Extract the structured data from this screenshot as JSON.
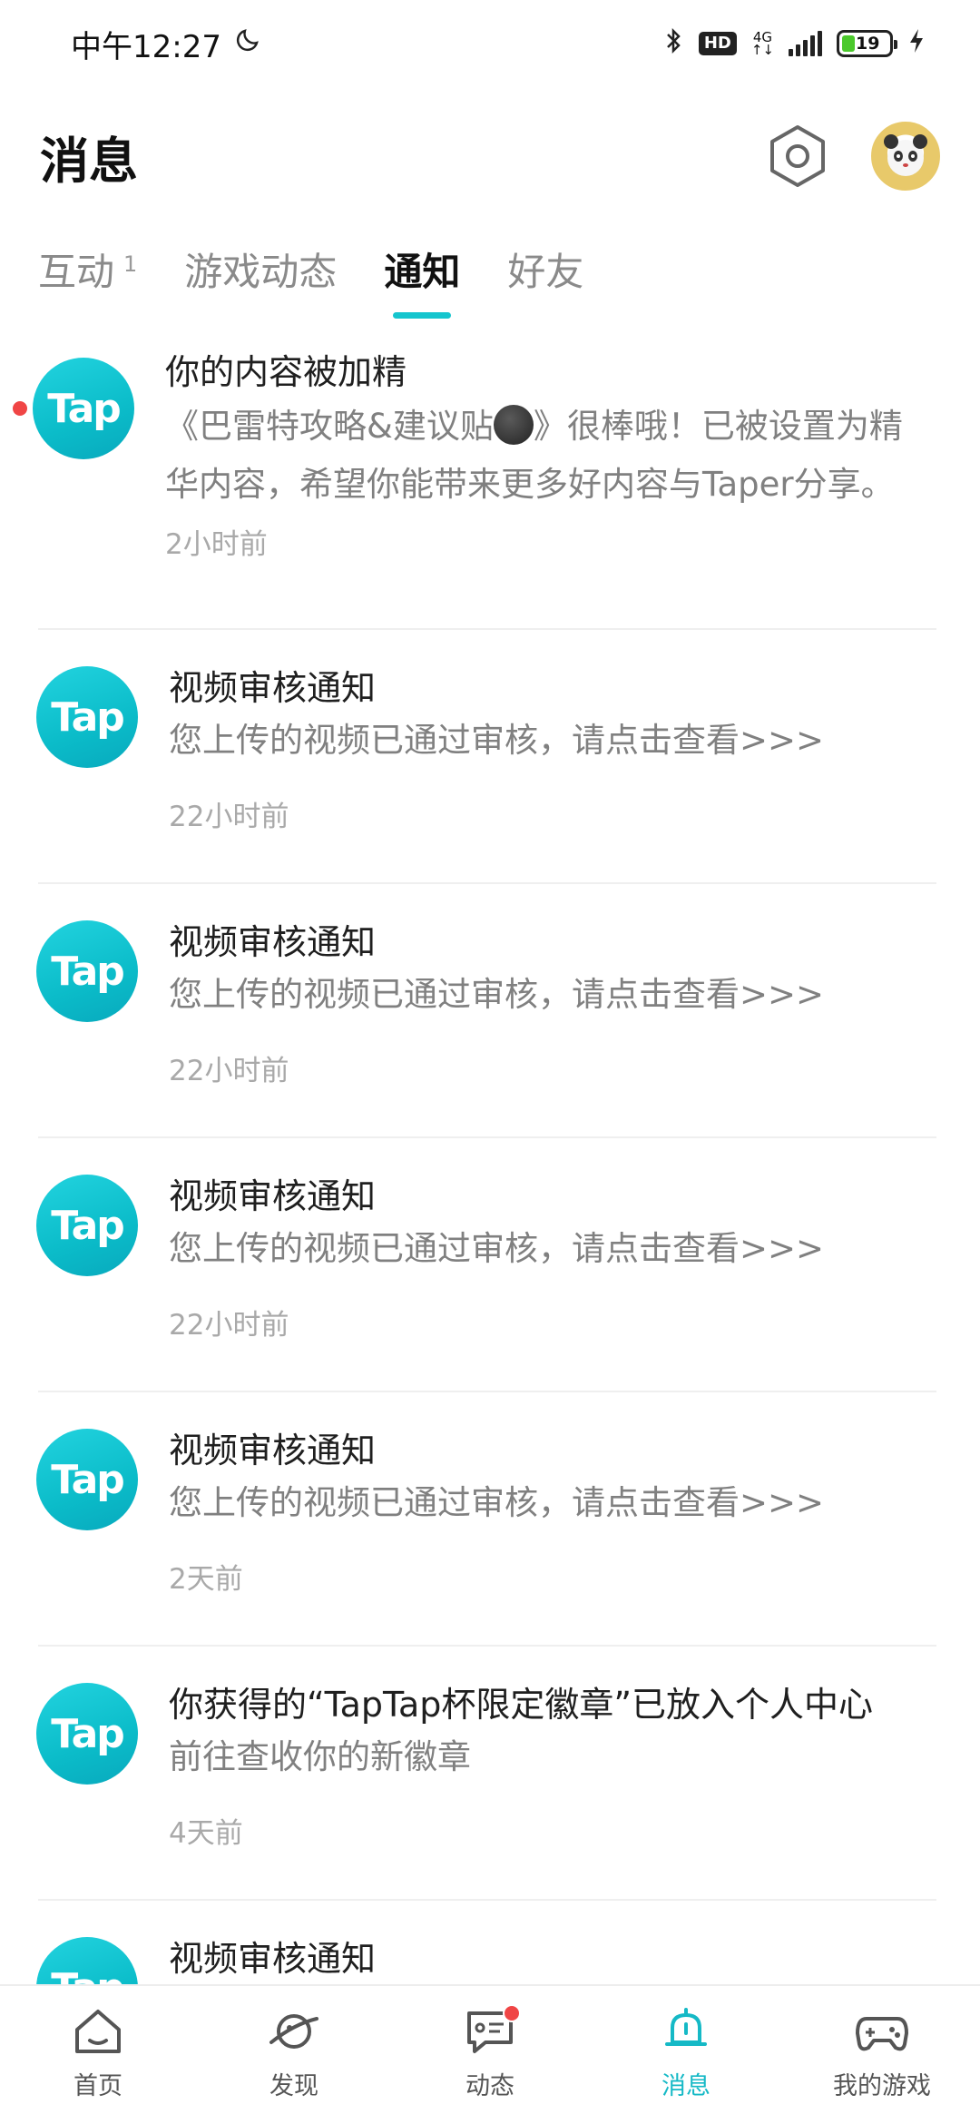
{
  "status_bar": {
    "time": "中午12:27",
    "hd": "HD",
    "network": "4G",
    "battery": "19"
  },
  "header": {
    "title": "消息"
  },
  "tabs": [
    {
      "label": "互动",
      "count": "1"
    },
    {
      "label": "游戏动态"
    },
    {
      "label": "通知",
      "active": true
    },
    {
      "label": "好友"
    }
  ],
  "notifications": [
    {
      "logo": "Tap",
      "title": "你的内容被加精",
      "desc_line1_a": "《巴雷特攻略&建议贴",
      "desc_line1_b": "》很棒哦！已被设置为精",
      "desc_line2": "华内容，希望你能带来更多好内容与Taper分享。",
      "time": "2小时前",
      "unread": true
    },
    {
      "logo": "Tap",
      "title": "视频审核通知",
      "desc": "您上传的视频已通过审核，请点击查看>>>",
      "time": "22小时前"
    },
    {
      "logo": "Tap",
      "title": "视频审核通知",
      "desc": "您上传的视频已通过审核，请点击查看>>>",
      "time": "22小时前"
    },
    {
      "logo": "Tap",
      "title": "视频审核通知",
      "desc": "您上传的视频已通过审核，请点击查看>>>",
      "time": "22小时前"
    },
    {
      "logo": "Tap",
      "title": "视频审核通知",
      "desc": "您上传的视频已通过审核，请点击查看>>>",
      "time": "2天前"
    },
    {
      "logo": "Tap",
      "title": "你获得的“TapTap杯限定徽章”已放入个人中心",
      "desc": "前往查收你的新徽章",
      "time": "4天前"
    },
    {
      "logo": "Tap",
      "title": "视频审核通知"
    }
  ],
  "bottom_nav": [
    {
      "label": "首页",
      "icon": "home-icon"
    },
    {
      "label": "发现",
      "icon": "planet-icon"
    },
    {
      "label": "动态",
      "icon": "chat-icon",
      "badge": true
    },
    {
      "label": "消息",
      "icon": "bell-icon",
      "active": true
    },
    {
      "label": "我的游戏",
      "icon": "gamepad-icon"
    }
  ],
  "colors": {
    "accent": "#15c5ce",
    "badge": "#f04545",
    "logo": "#0bbcc9"
  }
}
